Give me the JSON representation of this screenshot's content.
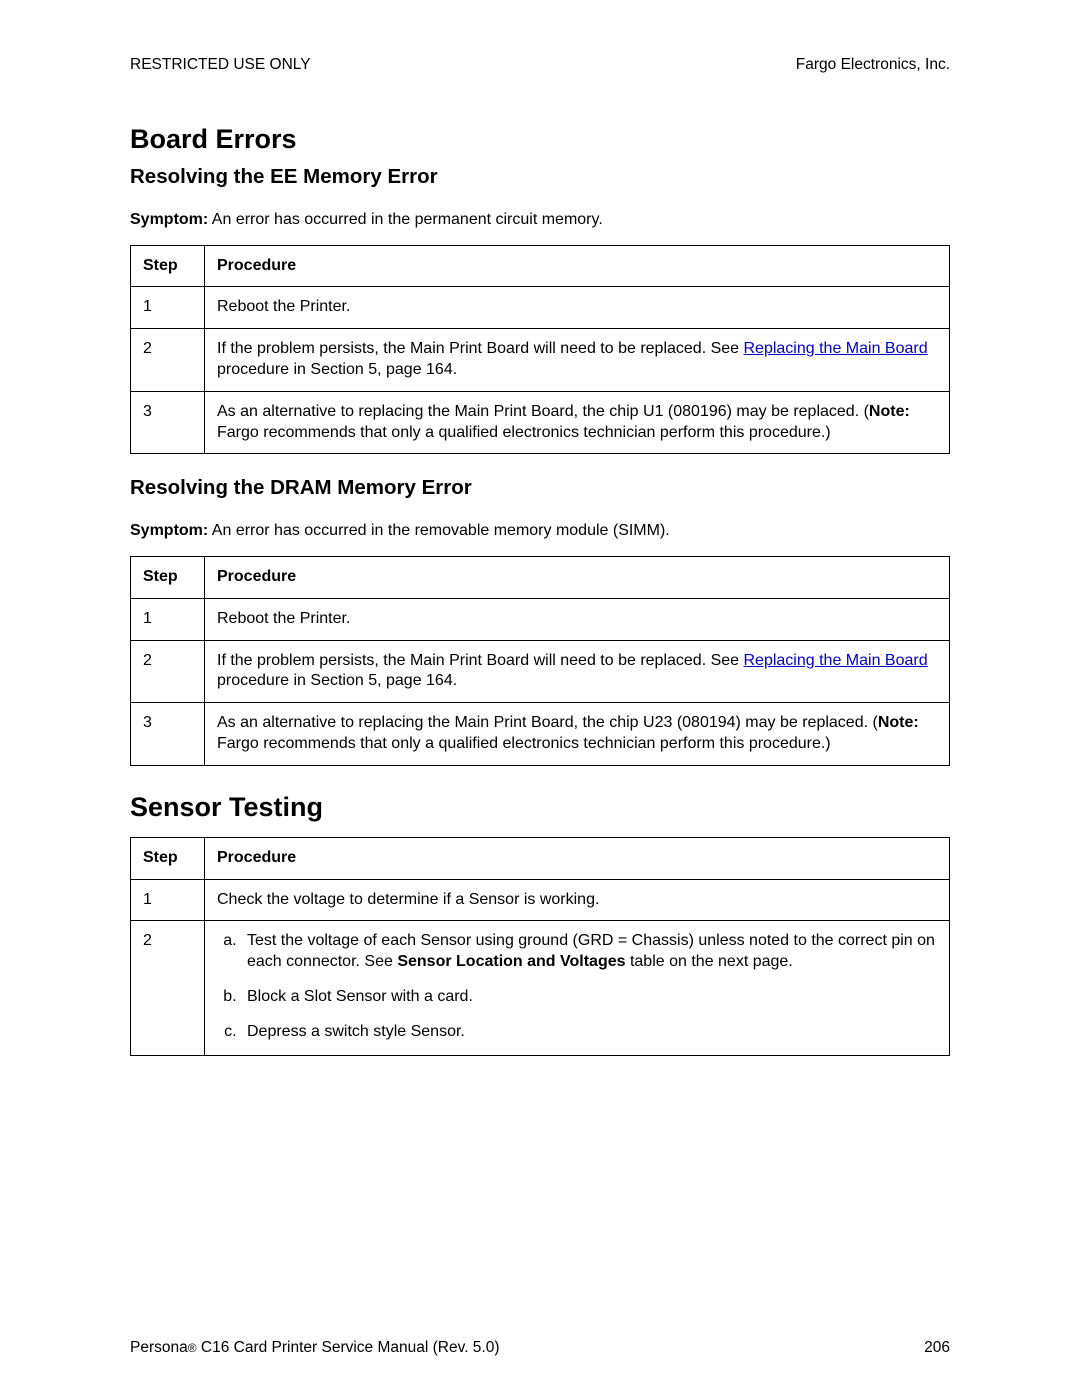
{
  "header": {
    "left": "RESTRICTED USE ONLY",
    "right": "Fargo Electronics, Inc."
  },
  "section1": {
    "title": "Board Errors",
    "sub1": {
      "title": "Resolving the EE Memory Error",
      "symptom_label": "Symptom:",
      "symptom_text": "  An error has occurred in the permanent circuit memory.",
      "col_step": "Step",
      "col_proc": "Procedure",
      "rows": {
        "r1": {
          "step": "1",
          "text": "Reboot the Printer."
        },
        "r2": {
          "step": "2",
          "pre": "If the problem persists, the Main Print Board will need to be replaced. See ",
          "link": "Replacing the Main Board",
          "post": " procedure in Section 5, page 164."
        },
        "r3": {
          "step": "3",
          "pre": "As an alternative to replacing the Main Print Board, the chip U1 (080196) may be replaced. (",
          "note_label": "Note:",
          "post": "  Fargo recommends that only a qualified electronics technician perform this procedure.)"
        }
      }
    },
    "sub2": {
      "title": "Resolving the DRAM Memory Error",
      "symptom_label": "Symptom:",
      "symptom_text": "  An error has occurred in the removable memory module (SIMM).",
      "col_step": "Step",
      "col_proc": "Procedure",
      "rows": {
        "r1": {
          "step": "1",
          "text": "Reboot the Printer."
        },
        "r2": {
          "step": "2",
          "pre": "If the problem persists, the Main Print Board will need to be replaced. See ",
          "link": "Replacing the Main Board",
          "post": " procedure in Section 5, page 164."
        },
        "r3": {
          "step": "3",
          "pre": "As an alternative to replacing the Main Print Board, the chip U23 (080194) may be replaced. (",
          "note_label": "Note:",
          "post": "  Fargo recommends that only a qualified electronics technician perform this procedure.)"
        }
      }
    }
  },
  "section2": {
    "title": "Sensor Testing",
    "col_step": "Step",
    "col_proc": "Procedure",
    "rows": {
      "r1": {
        "step": "1",
        "text": "Check the voltage to determine if a Sensor is working."
      },
      "r2": {
        "step": "2",
        "a_pre": "Test the voltage of each Sensor using ground (GRD = Chassis) unless noted to the correct pin on each connector. See ",
        "a_bold": "Sensor Location and Voltages",
        "a_post": " table on the next page.",
        "b": "Block a Slot Sensor with a card.",
        "c": "Depress a switch style Sensor."
      }
    }
  },
  "footer": {
    "left_pre": "Persona",
    "left_post": " C16 Card Printer Service Manual (Rev. 5.0)",
    "page": "206"
  }
}
